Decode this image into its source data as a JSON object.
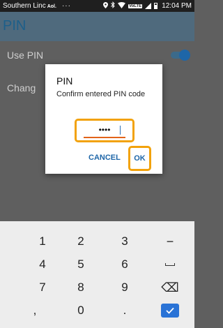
{
  "status_bar": {
    "carrier": "Southern Linc",
    "carrier_badge": "Aol.",
    "overflow": "···",
    "volte": "VoLTE",
    "time": "12:04 PM"
  },
  "app_bar": {
    "title": "PIN"
  },
  "settings": {
    "use_pin_label": "Use PIN",
    "use_pin_enabled": true,
    "change_label": "Chang"
  },
  "dialog": {
    "title": "PIN",
    "message": "Confirm entered PIN code",
    "pin_value": "••••",
    "cancel_label": "CANCEL",
    "ok_label": "OK"
  },
  "keyboard": {
    "rows": [
      [
        "1",
        "2",
        "3",
        "−"
      ],
      [
        "4",
        "5",
        "6",
        "space"
      ],
      [
        "7",
        "8",
        "9",
        "backspace"
      ],
      [
        ",",
        "0",
        ".",
        "done"
      ]
    ],
    "backspace_glyph": "⌫",
    "done_glyph": "✓"
  },
  "colors": {
    "accent": "#1e66a8",
    "highlight": "#f2a20c",
    "done_button": "#2a73d6"
  }
}
